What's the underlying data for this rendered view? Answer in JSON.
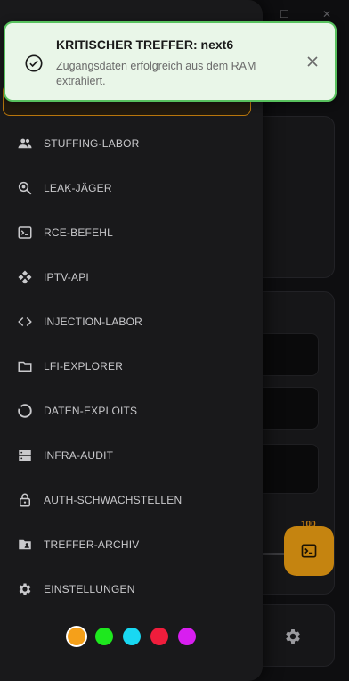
{
  "toast": {
    "title": "KRITISCHER TREFFER: next6",
    "message": "Zugangsdaten erfolgreich aus dem RAM extrahiert.",
    "icon": "check-circle-icon",
    "close_icon": "close-icon"
  },
  "drawer": {
    "items": [
      {
        "label": "STUFFING-LABOR",
        "icon": "people-icon"
      },
      {
        "label": "LEAK-JÄGER",
        "icon": "search-scan-icon"
      },
      {
        "label": "RCE-BEFEHL",
        "icon": "terminal-icon"
      },
      {
        "label": "IPTV-API",
        "icon": "api-icon"
      },
      {
        "label": "INJECTION-LABOR",
        "icon": "code-icon"
      },
      {
        "label": "LFI-EXPLORER",
        "icon": "folder-icon"
      },
      {
        "label": "DATEN-EXPLOITS",
        "icon": "spinner-icon"
      },
      {
        "label": "INFRA-AUDIT",
        "icon": "server-icon"
      },
      {
        "label": "AUTH-SCHWACHSTELLEN",
        "icon": "lock-icon"
      },
      {
        "label": "TREFFER-ARCHIV",
        "icon": "folder-user-icon"
      },
      {
        "label": "EINSTELLUNGEN",
        "icon": "gear-icon"
      }
    ],
    "theme_colors": [
      "#f5a01a",
      "#1ee81e",
      "#19d8f2",
      "#f01d3c",
      "#d81ef0"
    ],
    "active_theme": "#f5a01a"
  },
  "background": {
    "slider_value": "100",
    "fab_icon": "terminal-icon",
    "settings_icon": "gear-icon",
    "accent": "#c58410"
  }
}
